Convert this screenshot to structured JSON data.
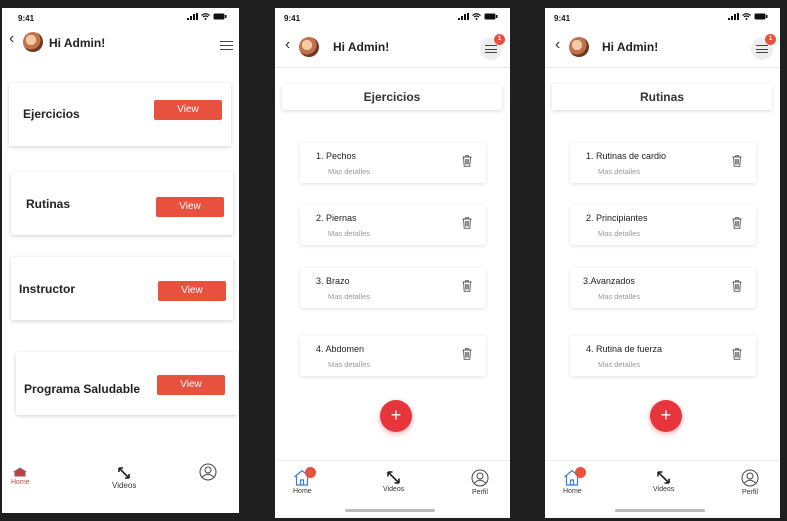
{
  "status_time": "9:41",
  "greeting": "Hi Admin!",
  "notification_count": "1",
  "home_screen": {
    "cards": [
      {
        "label": "Ejercicios",
        "button": "View"
      },
      {
        "label": "Rutinas",
        "button": "View"
      },
      {
        "label": "Instructor",
        "button": "View"
      },
      {
        "label": "Programa Saludable",
        "button": "View"
      }
    ],
    "tabs": {
      "home": "Home",
      "videos": "Videos"
    }
  },
  "ejercicios_screen": {
    "title": "Ejercicios",
    "items": [
      {
        "name": "1. Pechos",
        "details": "Mas detalles"
      },
      {
        "name": "2. Piernas",
        "details": "Mas detalles"
      },
      {
        "name": "3.  Brazo",
        "details": "Mas detalles"
      },
      {
        "name": "4.  Abdomen",
        "details": "Mas detalles"
      }
    ],
    "add_symbol": "+",
    "tabs": {
      "home": "Home",
      "videos": "Videos",
      "profile": "Perfil"
    }
  },
  "rutinas_screen": {
    "title": "Rutinas",
    "items": [
      {
        "name": "1. Rutinas de cardio",
        "details": "Mas detalles"
      },
      {
        "name": "2.  Principiantes",
        "details": "Mas detalles"
      },
      {
        "name": "3.Avanzados",
        "details": "Mas detalles"
      },
      {
        "name": "4.  Rutina de fuerza",
        "details": "Mas detalles"
      }
    ],
    "add_symbol": "+",
    "tabs": {
      "home": "Home",
      "videos": "Videos",
      "profile": "Perfil"
    }
  },
  "colors": {
    "accent": "#e8513d",
    "fab": "#e8343b",
    "home_active": "#b5474a",
    "home_icon_blue": "#3b7bd6"
  },
  "icons": [
    "back-chevron-icon",
    "avatar",
    "menu-icon",
    "trash-icon",
    "plus-icon",
    "home-icon",
    "videos-icon",
    "profile-icon"
  ]
}
